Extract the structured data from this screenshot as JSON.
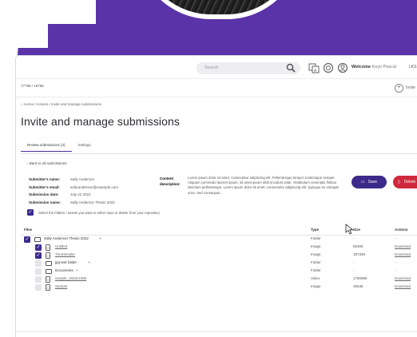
{
  "colors": {
    "background_purple": "#5b33a8",
    "accent": "#3c2a8a",
    "danger": "#d0283c"
  },
  "topbar": {
    "search_placeholder": "Search",
    "welcome_label": "Welcome",
    "user_name": "Koyn Pascal",
    "locale": "LKS",
    "icons": [
      "search-icon",
      "translate-icon",
      "help-icon",
      "user-icon"
    ]
  },
  "subbar": {
    "id_text": "77798 / 16786",
    "invite_label": "Invite"
  },
  "breadcrumb": "Home / Actions / Invite and manage submissions",
  "page_title": "Invite and manage submissions",
  "tabs": [
    {
      "label": "Review submissions (2)",
      "active": true
    },
    {
      "label": "Settings",
      "active": false
    }
  ],
  "back_label": "Back to all submissions",
  "submission": {
    "rows": [
      {
        "key": "Submitter's name:",
        "value": "Sally Anderson"
      },
      {
        "key": "Submitter's email:",
        "value": "sally.anderson@example.com"
      },
      {
        "key": "Submission date:",
        "value": "July 22 2022"
      },
      {
        "key": "Submission name:",
        "value": "Sally Anderson Thesis 2022"
      }
    ],
    "content_description_key": "Content description:",
    "content_description": "Lorem ipsum dolor sit amet, consectetur adipiscing elit. Pellentesque tempor scelerisque semper. Aliquam commodo laoreet ipsum, sit amet ipsum nibh tincidunt vitae. Vestibulum venenatis finibus interdum pellentesque. Lorem ipsum dolor sit amet, consectetur adipiscing elit. Quisque eu volutpat urna. Sed consequat..."
  },
  "buttons": {
    "save": "Save",
    "delete": "Delete"
  },
  "hint": "Select the folders / assets you want to either save or delete from your repository",
  "table": {
    "headers": {
      "files": "Files",
      "type": "Type",
      "size": "Size",
      "actions": "Actions"
    },
    "rows": [
      {
        "name": "Sally Anderson Thesis 2022",
        "plus": "+",
        "kind": "folder",
        "indent": 0,
        "checked": true,
        "type": "Folder",
        "size": "-",
        "action": "-",
        "link": false
      },
      {
        "name": "Untitled",
        "kind": "file",
        "indent": 1,
        "checked": true,
        "type": "Image",
        "size": "80305",
        "action": "Download",
        "link": true
      },
      {
        "name": "Thumbnailer",
        "kind": "file",
        "indent": 1,
        "checked": true,
        "type": "Image",
        "size": "187339",
        "action": "Download",
        "link": true
      },
      {
        "name": "jpg test folder",
        "plus": "+",
        "kind": "folder",
        "indent": 1,
        "checked": false,
        "type": "Folder",
        "size": "-",
        "action": "-",
        "link": false
      },
      {
        "name": "Documents",
        "plus": "+",
        "kind": "folder",
        "indent": 1,
        "checked": false,
        "type": "Folder",
        "size": "-",
        "action": "-",
        "link": false
      },
      {
        "name": "sample_1920x1080",
        "kind": "file",
        "indent": 1,
        "checked": false,
        "type": "Video",
        "size": "1780990",
        "action": "Download",
        "link": true
      },
      {
        "name": "Sample",
        "kind": "file",
        "indent": 1,
        "checked": false,
        "type": "Image",
        "size": "49535",
        "action": "Download",
        "link": true
      }
    ]
  }
}
